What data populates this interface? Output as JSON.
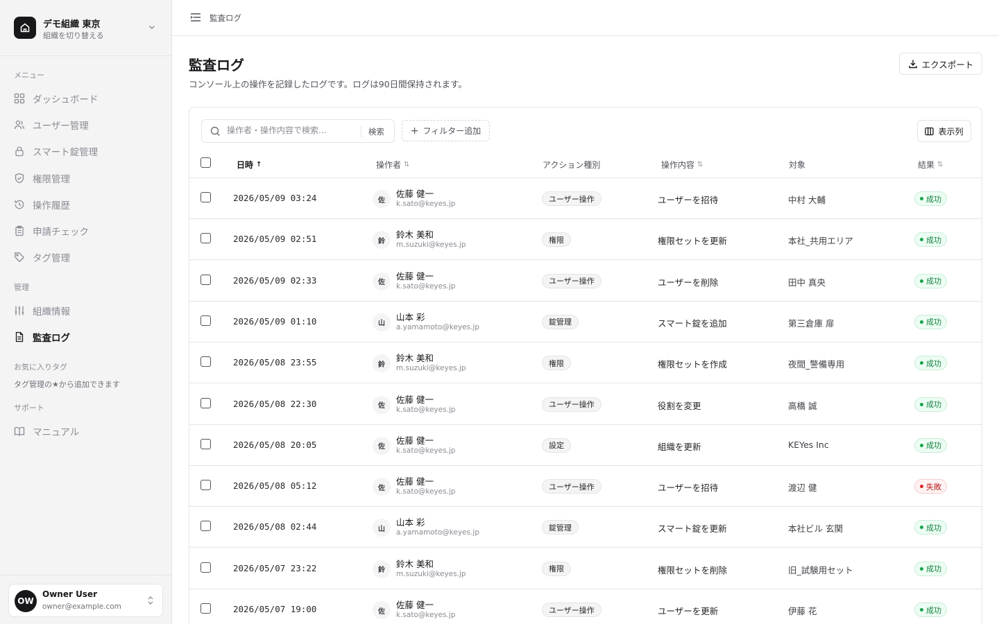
{
  "org": {
    "name": "デモ組織 東京",
    "switch_label": "組織を切り替える"
  },
  "sidebar": {
    "menu_label": "メニュー",
    "menu_items": [
      {
        "label": "ダッシュボード",
        "icon": "dashboard-icon"
      },
      {
        "label": "ユーザー管理",
        "icon": "users-icon"
      },
      {
        "label": "スマート錠管理",
        "icon": "lock-icon"
      },
      {
        "label": "権限管理",
        "icon": "shield-icon"
      },
      {
        "label": "操作履歴",
        "icon": "history-icon"
      },
      {
        "label": "申請チェック",
        "icon": "clipboard-icon"
      },
      {
        "label": "タグ管理",
        "icon": "tag-icon"
      }
    ],
    "admin_label": "管理",
    "admin_items": [
      {
        "label": "組織情報",
        "icon": "sliders-icon"
      },
      {
        "label": "監査ログ",
        "icon": "file-icon",
        "active": true
      }
    ],
    "fav_label": "お気に入りタグ",
    "fav_hint": "タグ管理の★から追加できます",
    "support_label": "サポート",
    "support_items": [
      {
        "label": "マニュアル",
        "icon": "book-icon"
      }
    ]
  },
  "user": {
    "initials": "OW",
    "name": "Owner User",
    "email": "owner@example.com"
  },
  "header": {
    "breadcrumb": "監査ログ"
  },
  "page": {
    "title": "監査ログ",
    "description": "コンソール上の操作を記録したログです。ログは90日間保持されます。",
    "export_label": "エクスポート"
  },
  "toolbar": {
    "search_placeholder": "操作者・操作内容で検索...",
    "search_button": "検索",
    "filter_button": "フィルター追加",
    "columns_button": "表示列"
  },
  "table": {
    "columns": {
      "datetime": "日時",
      "operator": "操作者",
      "action_type": "アクション種別",
      "operation": "操作内容",
      "target": "対象",
      "result": "結果"
    },
    "rows": [
      {
        "datetime": "2026/05/09 03:24",
        "avatar": "佐",
        "name": "佐藤 健一",
        "email": "k.sato@keyes.jp",
        "type": "ユーザー操作",
        "operation": "ユーザーを招待",
        "target": "中村 大輔",
        "result": "成功",
        "status": "ok"
      },
      {
        "datetime": "2026/05/09 02:51",
        "avatar": "鈴",
        "name": "鈴木 美和",
        "email": "m.suzuki@keyes.jp",
        "type": "権限",
        "operation": "権限セットを更新",
        "target": "本社_共用エリア",
        "result": "成功",
        "status": "ok"
      },
      {
        "datetime": "2026/05/09 02:33",
        "avatar": "佐",
        "name": "佐藤 健一",
        "email": "k.sato@keyes.jp",
        "type": "ユーザー操作",
        "operation": "ユーザーを削除",
        "target": "田中 真央",
        "result": "成功",
        "status": "ok"
      },
      {
        "datetime": "2026/05/09 01:10",
        "avatar": "山",
        "name": "山本 彩",
        "email": "a.yamamoto@keyes.jp",
        "type": "錠管理",
        "operation": "スマート錠を追加",
        "target": "第三倉庫 扉",
        "result": "成功",
        "status": "ok"
      },
      {
        "datetime": "2026/05/08 23:55",
        "avatar": "鈴",
        "name": "鈴木 美和",
        "email": "m.suzuki@keyes.jp",
        "type": "権限",
        "operation": "権限セットを作成",
        "target": "夜間_警備専用",
        "result": "成功",
        "status": "ok"
      },
      {
        "datetime": "2026/05/08 22:30",
        "avatar": "佐",
        "name": "佐藤 健一",
        "email": "k.sato@keyes.jp",
        "type": "ユーザー操作",
        "operation": "役割を変更",
        "target": "高橋 誠",
        "result": "成功",
        "status": "ok"
      },
      {
        "datetime": "2026/05/08 20:05",
        "avatar": "佐",
        "name": "佐藤 健一",
        "email": "k.sato@keyes.jp",
        "type": "設定",
        "operation": "組織を更新",
        "target": "KEYes Inc",
        "result": "成功",
        "status": "ok"
      },
      {
        "datetime": "2026/05/08 05:12",
        "avatar": "佐",
        "name": "佐藤 健一",
        "email": "k.sato@keyes.jp",
        "type": "ユーザー操作",
        "operation": "ユーザーを招待",
        "target": "渡辺 健",
        "result": "失敗",
        "status": "ng"
      },
      {
        "datetime": "2026/05/08 02:44",
        "avatar": "山",
        "name": "山本 彩",
        "email": "a.yamamoto@keyes.jp",
        "type": "錠管理",
        "operation": "スマート錠を更新",
        "target": "本社ビル 玄関",
        "result": "成功",
        "status": "ok"
      },
      {
        "datetime": "2026/05/07 23:22",
        "avatar": "鈴",
        "name": "鈴木 美和",
        "email": "m.suzuki@keyes.jp",
        "type": "権限",
        "operation": "権限セットを削除",
        "target": "旧_試験用セット",
        "result": "成功",
        "status": "ok"
      },
      {
        "datetime": "2026/05/07 19:00",
        "avatar": "佐",
        "name": "佐藤 健一",
        "email": "k.sato@keyes.jp",
        "type": "ユーザー操作",
        "operation": "ユーザーを更新",
        "target": "伊藤 花",
        "result": "成功",
        "status": "ok"
      }
    ]
  }
}
